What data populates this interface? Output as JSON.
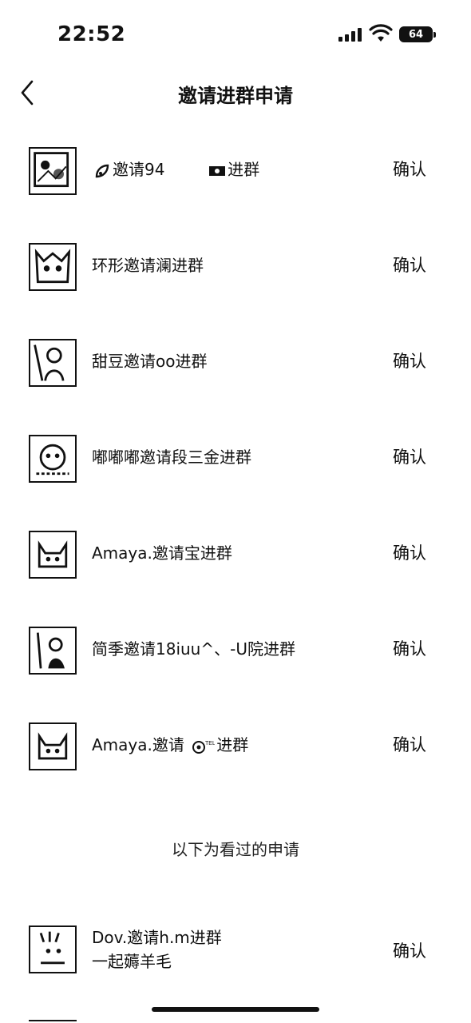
{
  "status": {
    "time": "22:52",
    "battery": "64"
  },
  "nav": {
    "title": "邀请进群申请"
  },
  "requests": [
    {
      "text": "邀请94",
      "text_suffix": "进群",
      "confirm": "确认"
    },
    {
      "text": "环形邀请澜进群",
      "confirm": "确认"
    },
    {
      "text": "甜豆邀请oo进群",
      "confirm": "确认"
    },
    {
      "text": "嘟嘟嘟邀请段三金进群",
      "confirm": "确认"
    },
    {
      "text": "Amaya.邀请宝进群",
      "confirm": "确认"
    },
    {
      "text": "简季邀请18iuu^、-U院进群",
      "confirm": "确认"
    },
    {
      "text": "Amaya.邀请",
      "text_suffix": "进群",
      "confirm": "确认"
    }
  ],
  "section_label": "以下为看过的申请",
  "viewed": [
    {
      "text": "Dov.邀请h.m进群",
      "subtext": "一起薅羊毛",
      "confirm": "确认"
    }
  ],
  "icons": {
    "back": "chevron-left-icon",
    "signal": "cellular-signal-icon",
    "wifi": "wifi-icon",
    "battery": "battery-icon"
  }
}
